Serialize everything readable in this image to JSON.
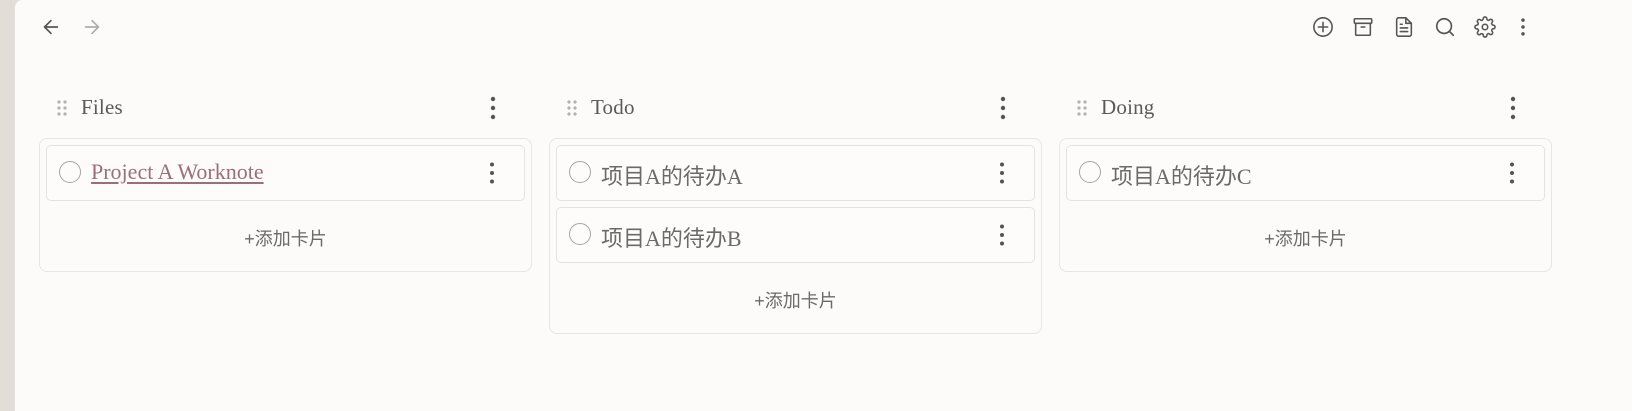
{
  "toolbar": {
    "left": [
      {
        "name": "back-arrow-icon"
      },
      {
        "name": "forward-arrow-icon",
        "disabled": true
      }
    ],
    "right": [
      {
        "name": "add-circle-icon"
      },
      {
        "name": "archive-icon"
      },
      {
        "name": "document-icon"
      },
      {
        "name": "search-icon"
      },
      {
        "name": "gear-icon"
      },
      {
        "name": "more-vertical-icon"
      }
    ]
  },
  "board": {
    "add_card_label": "+添加卡片",
    "columns": [
      {
        "title": "Files",
        "cards": [
          {
            "text": "Project A Worknote",
            "is_link": true
          }
        ]
      },
      {
        "title": "Todo",
        "cards": [
          {
            "text": "项目A的待办A",
            "is_link": false
          },
          {
            "text": "项目A的待办B",
            "is_link": false
          }
        ]
      },
      {
        "title": "Doing",
        "cards": [
          {
            "text": "项目A的待办C",
            "is_link": false
          }
        ]
      }
    ]
  },
  "colors": {
    "background": "#fdfbf9",
    "link": "#9a6f78",
    "icon": "#555555",
    "icon_disabled": "#b0aca8"
  }
}
